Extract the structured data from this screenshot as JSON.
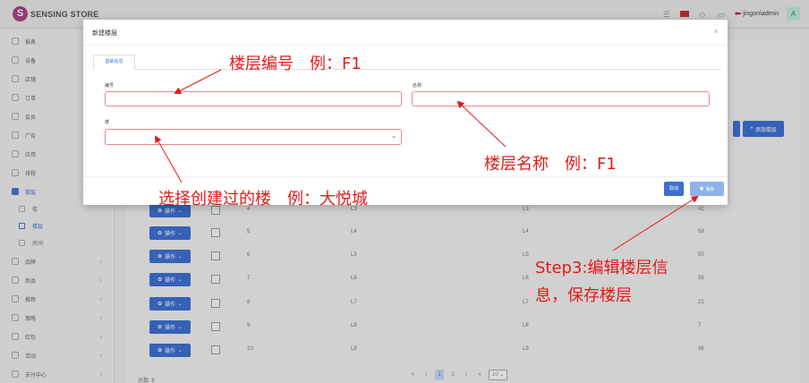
{
  "app": {
    "logo_mark": "S",
    "logo_text": "SENSING STORE",
    "collapse_icon": "chevron-left-icon"
  },
  "header": {
    "user_label": "jingon\\admin",
    "avatar": "A"
  },
  "sidebar": {
    "items": [
      {
        "label": "报表",
        "icon": "chart-icon"
      },
      {
        "label": "设备",
        "icon": "device-icon"
      },
      {
        "label": "店铺",
        "icon": "store-icon"
      },
      {
        "label": "订单",
        "icon": "order-icon"
      },
      {
        "label": "会员",
        "icon": "member-icon"
      },
      {
        "label": "广告",
        "icon": "ad-icon"
      },
      {
        "label": "应用",
        "icon": "app-icon"
      },
      {
        "label": "排程",
        "icon": "schedule-icon"
      },
      {
        "label": "楼层",
        "icon": "floor-icon",
        "active": true
      }
    ],
    "subitems": [
      {
        "label": "楼"
      },
      {
        "label": "楼层",
        "active": true
      },
      {
        "label": "房间"
      }
    ],
    "items2": [
      {
        "label": "品牌",
        "icon": "brand-icon"
      },
      {
        "label": "商品",
        "icon": "product-icon"
      },
      {
        "label": "推荐",
        "icon": "star-icon"
      },
      {
        "label": "策略",
        "icon": "strategy-icon"
      },
      {
        "label": "红包",
        "icon": "redpacket-icon"
      },
      {
        "label": "活动",
        "icon": "activity-icon"
      },
      {
        "label": "支付中心",
        "icon": "pay-icon"
      }
    ]
  },
  "toolbar": {
    "add_floor": "添加楼层"
  },
  "table": {
    "op_label": "操作",
    "rows": [
      {
        "no": "4",
        "code": "L3",
        "name": "L3",
        "count": "42"
      },
      {
        "no": "5",
        "code": "L4",
        "name": "L4",
        "count": "58"
      },
      {
        "no": "6",
        "code": "L5",
        "name": "L5",
        "count": "50"
      },
      {
        "no": "7",
        "code": "L6",
        "name": "L6",
        "count": "56"
      },
      {
        "no": "8",
        "code": "L7",
        "name": "L7",
        "count": "21"
      },
      {
        "no": "9",
        "code": "L8",
        "name": "L8",
        "count": "7"
      },
      {
        "no": "10",
        "code": "L9",
        "name": "L9",
        "count": "36"
      }
    ],
    "total": "总数: 8"
  },
  "pager": {
    "first": "«",
    "prev": "‹",
    "current": "1",
    "next_page": "2",
    "next": "›",
    "last": "»",
    "size": "10"
  },
  "modal": {
    "title": "新建楼层",
    "tab": "基础信息",
    "code_label": "编号",
    "name_label": "名称",
    "building_label": "楼",
    "cancel": "取消",
    "save": "保存"
  },
  "annotations": {
    "floor_code": "楼层编号　例：F1",
    "floor_name": "楼层名称　例：F1",
    "building": "选择创建过的楼　例：大悦城",
    "step_line1": "Step3:编辑楼层信",
    "step_line2": "息，保存楼层"
  },
  "colors": {
    "accent": "#3d6fd1",
    "annotation": "#e21a1a",
    "logo": "#a54583"
  }
}
